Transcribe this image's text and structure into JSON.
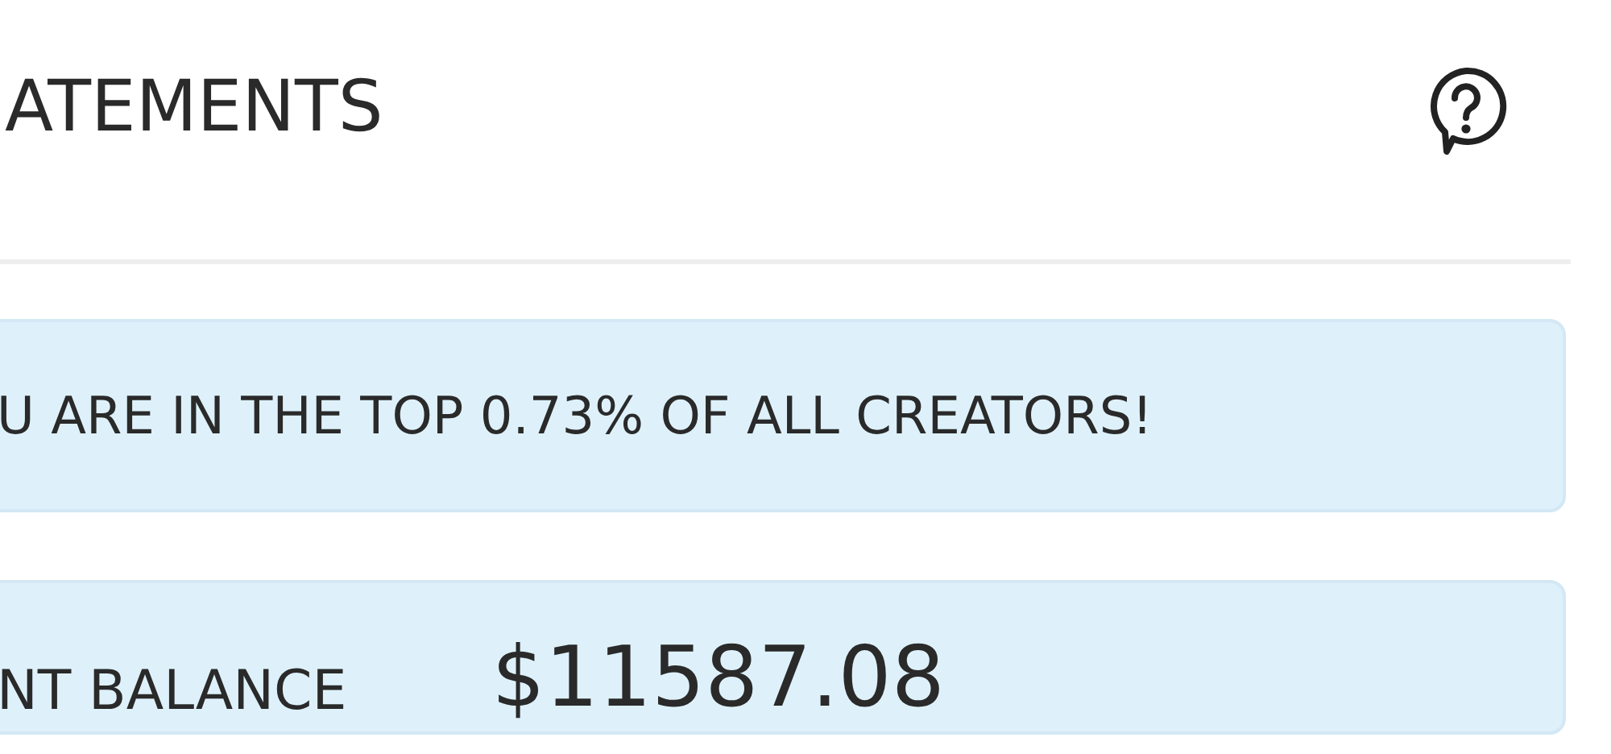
{
  "header": {
    "title": "ATEMENTS"
  },
  "banner": {
    "text": "U ARE IN THE TOP 0.73% OF ALL CREATORS!"
  },
  "balance": {
    "label": "NT BALANCE",
    "amount": "$11587.08"
  }
}
